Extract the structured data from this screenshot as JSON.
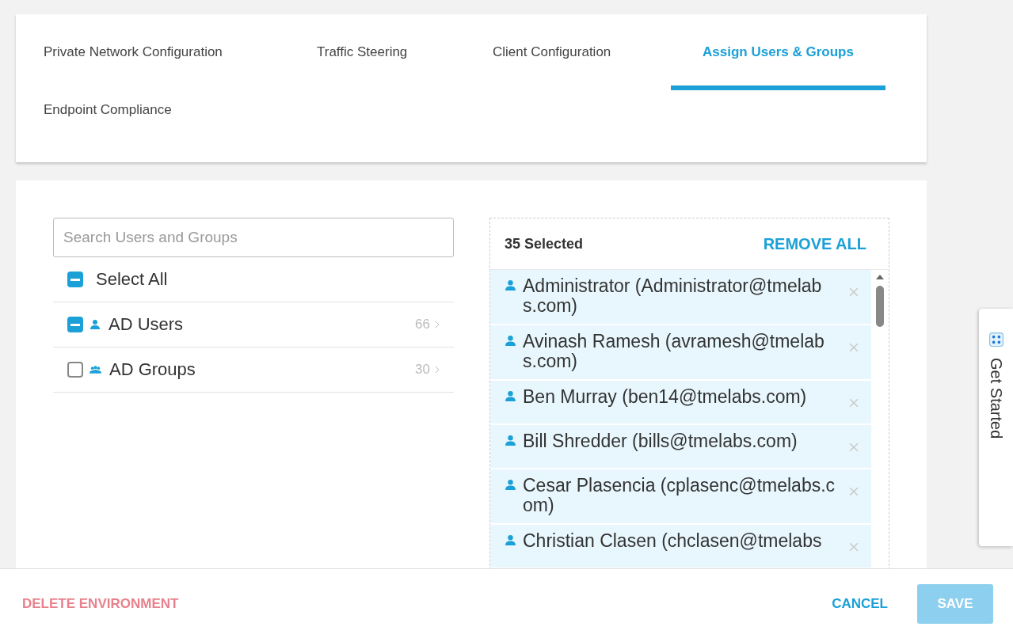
{
  "tabs": [
    {
      "label": "Private Network Configuration",
      "selected": false
    },
    {
      "label": "Traffic Steering",
      "selected": false
    },
    {
      "label": "Client Configuration",
      "selected": false
    },
    {
      "label": "Assign Users & Groups",
      "selected": true
    },
    {
      "label": "Endpoint Compliance",
      "selected": false
    }
  ],
  "search": {
    "placeholder": "Search Users and Groups"
  },
  "tree": [
    {
      "label": "Select All",
      "checked": true,
      "partial": true,
      "kind": "all"
    },
    {
      "label": "AD Users",
      "checked": true,
      "partial": true,
      "kind": "users",
      "count": "66"
    },
    {
      "label": "AD Groups",
      "checked": false,
      "kind": "groups",
      "count": "30"
    }
  ],
  "selected_panel": {
    "count": "35 Selected",
    "remove_all": "REMOVE ALL",
    "items": [
      {
        "label": "Administrator (Administrator@tmelabs.com)"
      },
      {
        "label": "Avinash Ramesh (avramesh@tmelabs.com)"
      },
      {
        "label": "Ben Murray (ben14@tmelabs.com)"
      },
      {
        "label": "Bill Shredder (bills@tmelabs.com)"
      },
      {
        "label": "Cesar Plasencia (cplasenc@tmelabs.com)"
      },
      {
        "label": "Christian Clasen (chclasen@tmelabs"
      }
    ]
  },
  "side_tab": {
    "label": "Get Started"
  },
  "footer": {
    "delete": "DELETE ENVIRONMENT",
    "cancel": "CANCEL",
    "save": "SAVE",
    "save_disabled": true
  }
}
